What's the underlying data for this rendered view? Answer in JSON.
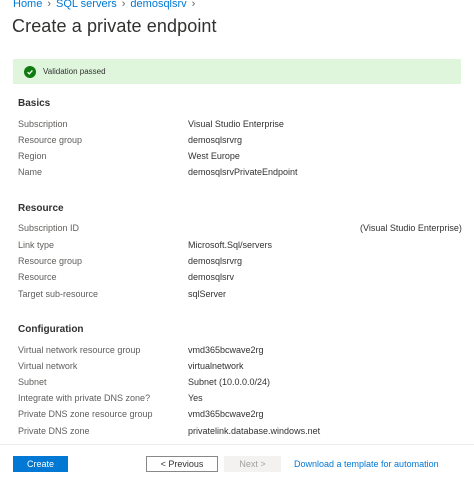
{
  "breadcrumb": [
    "Home",
    "SQL servers",
    "demosqlsrv"
  ],
  "page_title": "Create a private endpoint",
  "validation": {
    "text": "Validation passed"
  },
  "basics": {
    "heading": "Basics",
    "rows": [
      {
        "key": "Subscription",
        "value": "Visual Studio Enterprise"
      },
      {
        "key": "Resource group",
        "value": "demosqlsrvrg"
      },
      {
        "key": "Region",
        "value": "West Europe"
      },
      {
        "key": "Name",
        "value": "demosqlsrvPrivateEndpoint"
      }
    ]
  },
  "resource": {
    "heading": "Resource",
    "rows": [
      {
        "key": "Subscription ID",
        "value": "(Visual Studio Enterprise)"
      },
      {
        "key": "Link type",
        "value": "Microsoft.Sql/servers"
      },
      {
        "key": "Resource group",
        "value": "demosqlsrvrg"
      },
      {
        "key": "Resource",
        "value": "demosqlsrv"
      },
      {
        "key": "Target sub-resource",
        "value": "sqlServer"
      }
    ]
  },
  "configuration": {
    "heading": "Configuration",
    "rows": [
      {
        "key": "Virtual network resource group",
        "value": "vmd365bcwave2rg"
      },
      {
        "key": "Virtual network",
        "value": "virtualnetwork"
      },
      {
        "key": "Subnet",
        "value": "Subnet (10.0.0.0/24)"
      },
      {
        "key": "Integrate with private DNS zone?",
        "value": "Yes"
      },
      {
        "key": "Private DNS zone resource group",
        "value": "vmd365bcwave2rg"
      },
      {
        "key": "Private DNS zone",
        "value": "privatelink.database.windows.net"
      }
    ]
  },
  "footer": {
    "create_label": "Create",
    "previous_label": "< Previous",
    "next_label": "Next >",
    "template_link": "Download a template for automation"
  }
}
